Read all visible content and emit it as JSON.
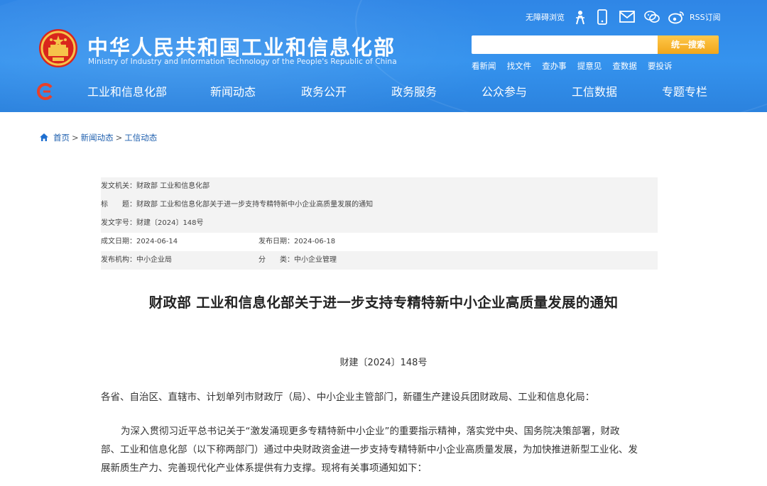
{
  "header": {
    "site_name": "中华人民共和国工业和信息化部",
    "site_name_en": "Ministry of Industry and Information Technology of the People's Republic of China",
    "tools": {
      "accessible": "无障碍浏览",
      "rss": "RSS订阅"
    },
    "search": {
      "placeholder": "",
      "button": "统一搜索"
    },
    "quick_links": [
      "看新闻",
      "找文件",
      "查办事",
      "提意见",
      "查数据",
      "要投诉"
    ]
  },
  "nav": {
    "items": [
      "工业和信息化部",
      "新闻动态",
      "政务公开",
      "政务服务",
      "公众参与",
      "工信数据",
      "专题专栏"
    ]
  },
  "breadcrumb": [
    "首页",
    "新闻动态",
    "工信动态"
  ],
  "breadcrumb_sep": ">",
  "meta": {
    "issuer": "发文机关：财政部 工业和信息化部",
    "title": "标　　题：财政部 工业和信息化部关于进一步支持专精特新中小企业高质量发展的通知",
    "doc_no": "发文字号：财建〔2024〕148号",
    "created": "成文日期：2024-06-14",
    "published": "发布日期：2024-06-18",
    "org": "发布机构：中小企业局",
    "category": "分　　类：中小企业管理"
  },
  "document": {
    "title": "财政部 工业和信息化部关于进一步支持专精特新中小企业高质量发展的通知",
    "number": "财建〔2024〕148号",
    "recipients": "各省、自治区、直辖市、计划单列市财政厅（局）、中小企业主管部门，新疆生产建设兵团财政局、工业和信息化局：",
    "para1_line1": "为深入贯彻习近平总书记关于“激发涌现更多专精特新中小企业”的重要指示精神，落实党中央、国务院决策部署，财政",
    "para1_line2": "部、工业和信息化部（以下称两部门）通过中央财政资金进一步支持专精特新中小企业高质量发展，为加快推进新型工业化、发",
    "para1_line3": "展新质生产力、完善现代化产业体系提供有力支撑。现将有关事项通知如下："
  }
}
